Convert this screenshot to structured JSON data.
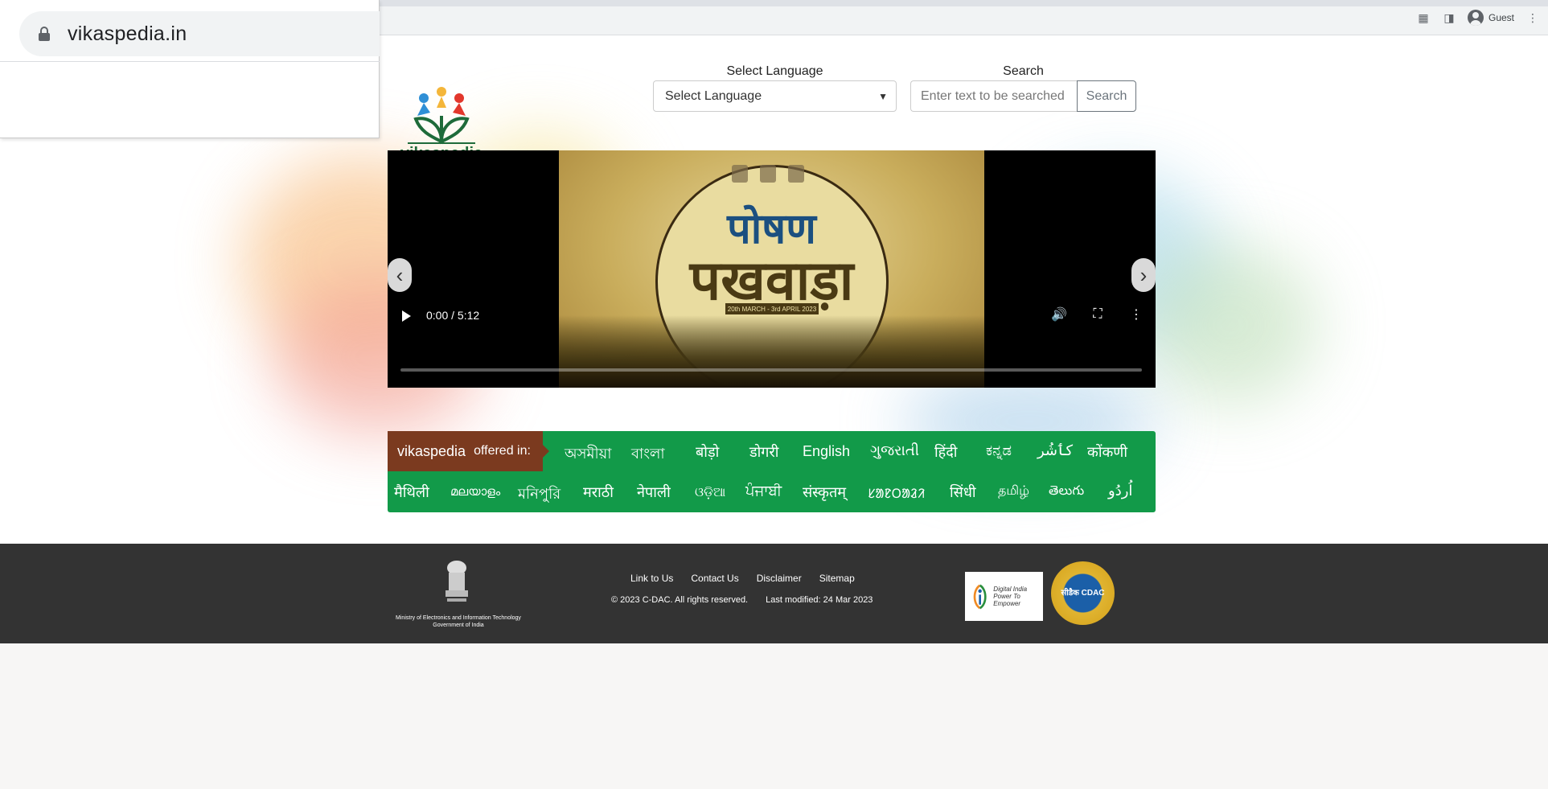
{
  "browser": {
    "url": "vikaspedia.in",
    "profile_label": "Guest"
  },
  "header": {
    "logo_text": "vikaspedia",
    "language_label": "Select Language",
    "language_selected": "Select Language",
    "search_label": "Search",
    "search_placeholder": "Enter text to be searched",
    "search_button": "Search"
  },
  "video": {
    "poster_title_line1": "पोषण",
    "poster_title_line2": "पखवाड़ा",
    "poster_date": "20th MARCH - 3rd APRIL 2023",
    "time": "0:00 / 5:12",
    "progress_fraction": 0
  },
  "languages": {
    "brand": "vikaspedia",
    "offered_label": "offered in:",
    "row1": [
      "অসমীয়া",
      "বাংলা",
      "बोड़ो",
      "डोगरी",
      "English",
      "ગુજરાતી",
      "हिंदी",
      "ಕನ್ನಡ",
      "کٲشُر",
      "कोंकणी"
    ],
    "row2": [
      "मैथिली",
      "മലയാളം",
      "মনিপুরি",
      "मराठी",
      "नेपाली",
      "ଓଡ଼ିଆ",
      "ਪੰਜਾਬੀ",
      "संस्कृतम्",
      "ᱥᱟᱱᱛᱟᱲᱤ",
      "सिंधी",
      "தமிழ்",
      "తెలుగు",
      "اُردُو"
    ]
  },
  "footer": {
    "ministry_line1": "Ministry of Electronics and Information Technology",
    "ministry_line2": "Government of India",
    "links": [
      "Link to Us",
      "Contact Us",
      "Disclaimer",
      "Sitemap"
    ],
    "copyright": "© 2023 C-DAC. All rights reserved.",
    "last_modified": "Last modified: 24 Mar 2023",
    "digital_india_line1": "Digital India",
    "digital_india_line2": "Power To Empower",
    "cdac_label": "सीडैक CDAC"
  },
  "colors": {
    "language_band": "#129a49",
    "offered_tag": "#7b3a1f",
    "footer_bg": "#333333",
    "logo_green": "#1e6b3a"
  }
}
